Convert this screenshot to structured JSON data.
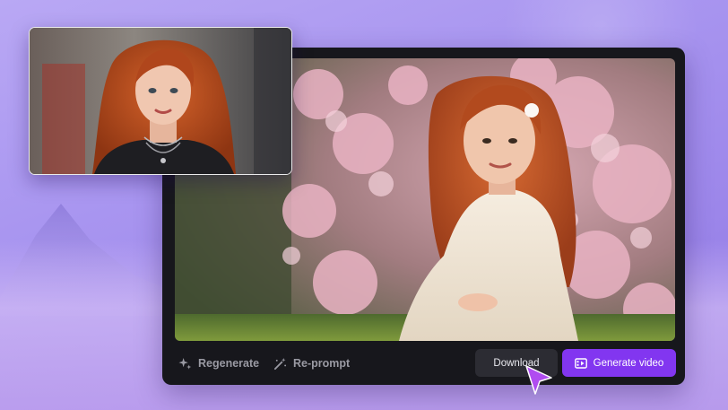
{
  "toolbar": {
    "regenerate_label": "Regenerate",
    "reprompt_label": "Re-prompt",
    "download_label": "Download",
    "generate_video_label": "Generate video"
  },
  "colors": {
    "accent": "#8236f0",
    "panel": "#17171c",
    "secondary_button": "#2c2c33",
    "background": "#a996f0"
  },
  "icons": {
    "regenerate": "sparkle-icon",
    "reprompt": "magic-wand-icon",
    "generate_video": "video-icon",
    "pointer": "cursor-icon"
  }
}
